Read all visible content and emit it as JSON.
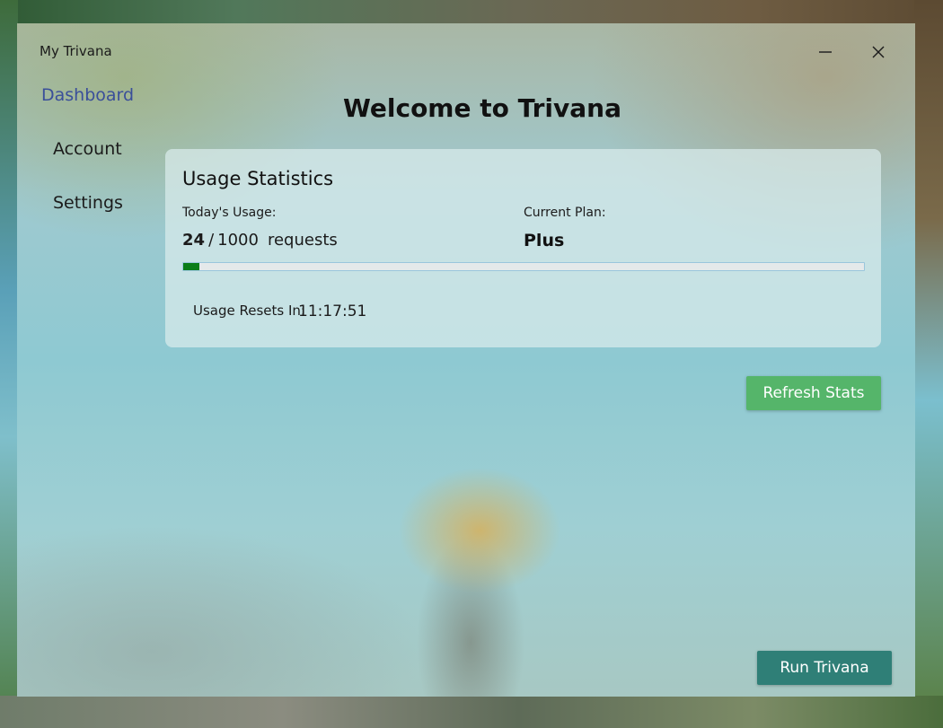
{
  "window": {
    "title": "My Trivana",
    "controls": {
      "minimize_icon": "minimize-icon",
      "close_icon": "close-icon"
    }
  },
  "sidebar": {
    "items": [
      {
        "label": "Dashboard",
        "active": true
      },
      {
        "label": "Account",
        "active": false
      },
      {
        "label": "Settings",
        "active": false
      }
    ]
  },
  "main": {
    "title": "Welcome to Trivana",
    "usage_card": {
      "title": "Usage Statistics",
      "today_label": "Today's Usage:",
      "used": "24",
      "separator": "/",
      "limit": "1000",
      "unit": "requests",
      "plan_label": "Current Plan:",
      "plan_value": "Plus",
      "progress_fraction": 0.024,
      "reset_label": "Usage Resets In:",
      "reset_value": "11:17:51"
    },
    "refresh_button": "Refresh Stats",
    "run_button": "Run Trivana"
  },
  "colors": {
    "accent_active_nav": "#3a4f9a",
    "progress_fill": "#0a7d18",
    "refresh_button": "#55b56a",
    "run_button": "#2f7f77"
  }
}
